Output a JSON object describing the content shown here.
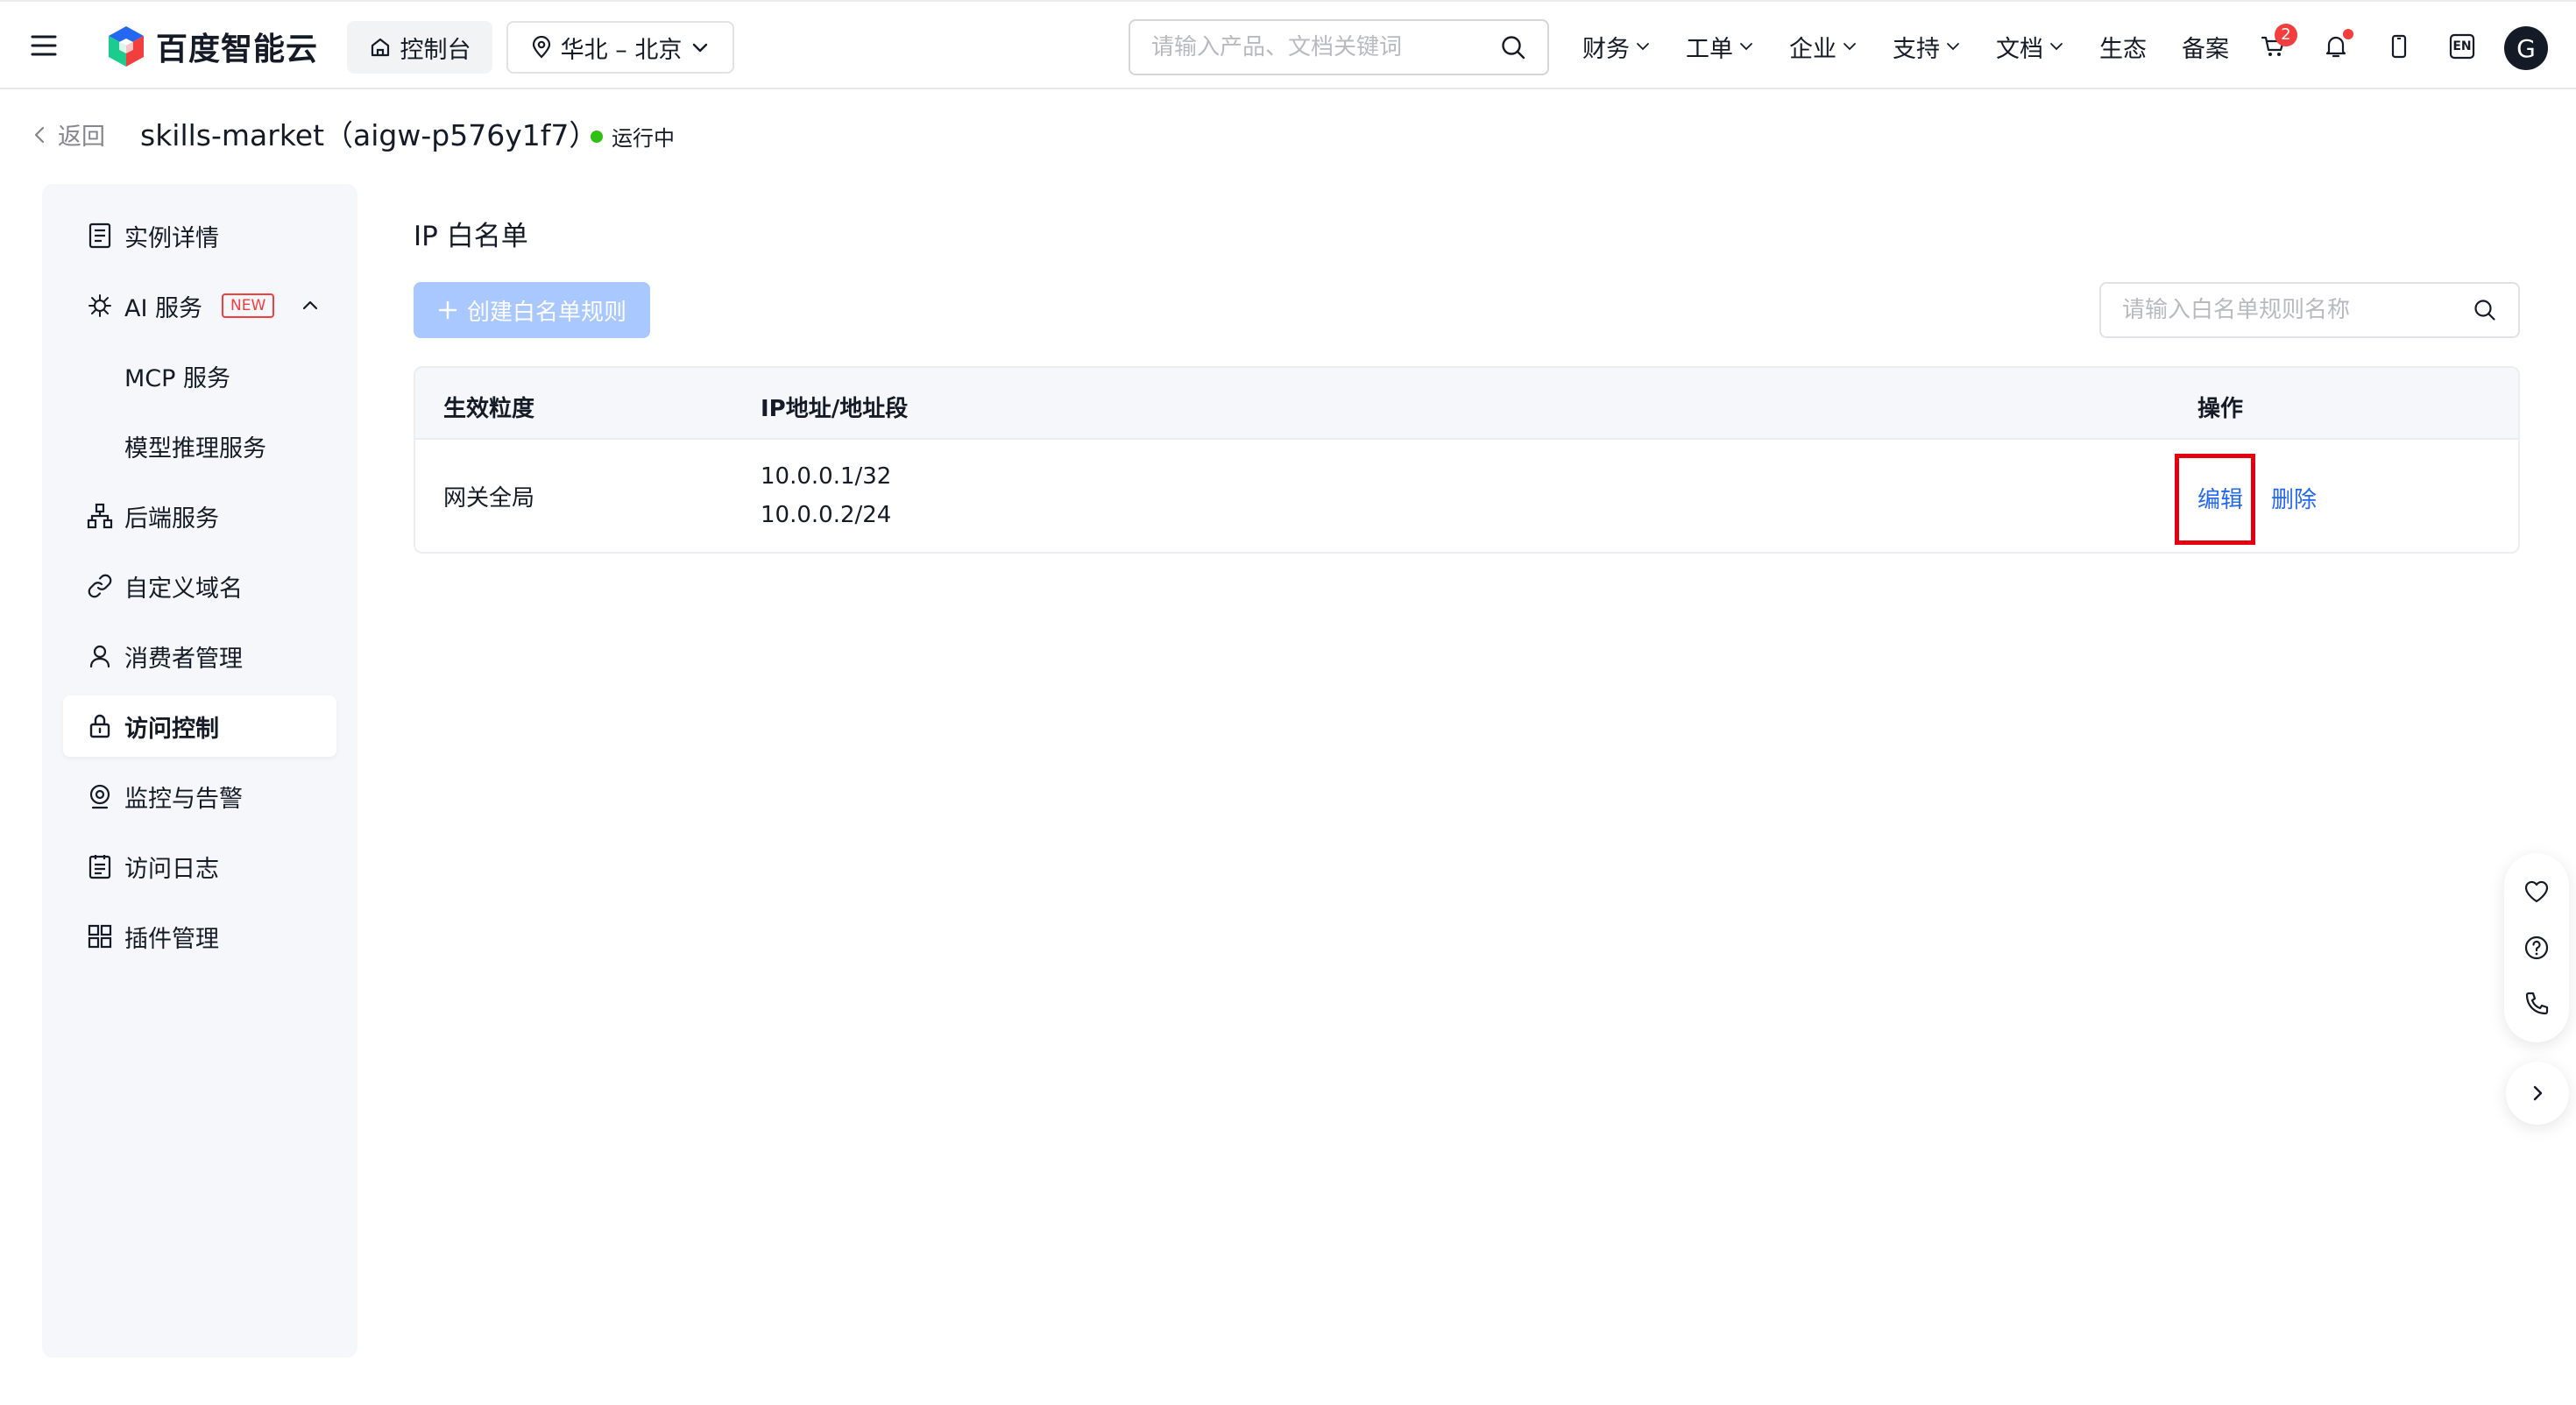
{
  "topbar": {
    "logo_text": "百度智能云",
    "console_label": "控制台",
    "region_label": "华北 – 北京",
    "search_placeholder": "请输入产品、文档关键词",
    "nav": [
      {
        "label": "财务",
        "has_dropdown": true
      },
      {
        "label": "工单",
        "has_dropdown": true
      },
      {
        "label": "企业",
        "has_dropdown": true
      },
      {
        "label": "支持",
        "has_dropdown": true
      },
      {
        "label": "文档",
        "has_dropdown": true
      },
      {
        "label": "生态",
        "has_dropdown": false
      },
      {
        "label": "备案",
        "has_dropdown": false
      }
    ],
    "cart_count": "2",
    "lang_label": "EN",
    "avatar_letter": "G"
  },
  "header": {
    "back_label": "返回",
    "title": "skills-market（aigw-p576y1f7）",
    "status": "运行中",
    "status_color": "#30bf13"
  },
  "sidebar": {
    "items": [
      {
        "label": "实例详情",
        "icon": "document-list-icon"
      },
      {
        "label": "AI 服务",
        "icon": "ai-service-icon",
        "badge": "NEW",
        "expanded": true
      },
      {
        "label": "MCP 服务",
        "sub": true
      },
      {
        "label": "模型推理服务",
        "sub": true
      },
      {
        "label": "后端服务",
        "icon": "hierarchy-icon"
      },
      {
        "label": "自定义域名",
        "icon": "link-icon"
      },
      {
        "label": "消费者管理",
        "icon": "user-icon"
      },
      {
        "label": "访问控制",
        "icon": "lock-icon",
        "active": true
      },
      {
        "label": "监控与告警",
        "icon": "monitor-icon"
      },
      {
        "label": "访问日志",
        "icon": "log-icon"
      },
      {
        "label": "插件管理",
        "icon": "grid-icon"
      }
    ]
  },
  "main": {
    "section_title": "IP 白名单",
    "create_button": "创建白名单规则",
    "search_placeholder": "请输入白名单规则名称",
    "table": {
      "columns": [
        "生效粒度",
        "IP地址/地址段",
        "操作"
      ],
      "rows": [
        {
          "scope": "网关全局",
          "ips": [
            "10.0.0.1/32",
            "10.0.0.2/24"
          ],
          "actions": [
            "编辑",
            "删除"
          ]
        }
      ]
    }
  },
  "colors": {
    "primary": "#2468f2",
    "primary_disabled": "#a8c8ff",
    "danger": "#f33e3e",
    "highlight": "#e3000f",
    "sidebar_bg": "#f5f7fa"
  }
}
